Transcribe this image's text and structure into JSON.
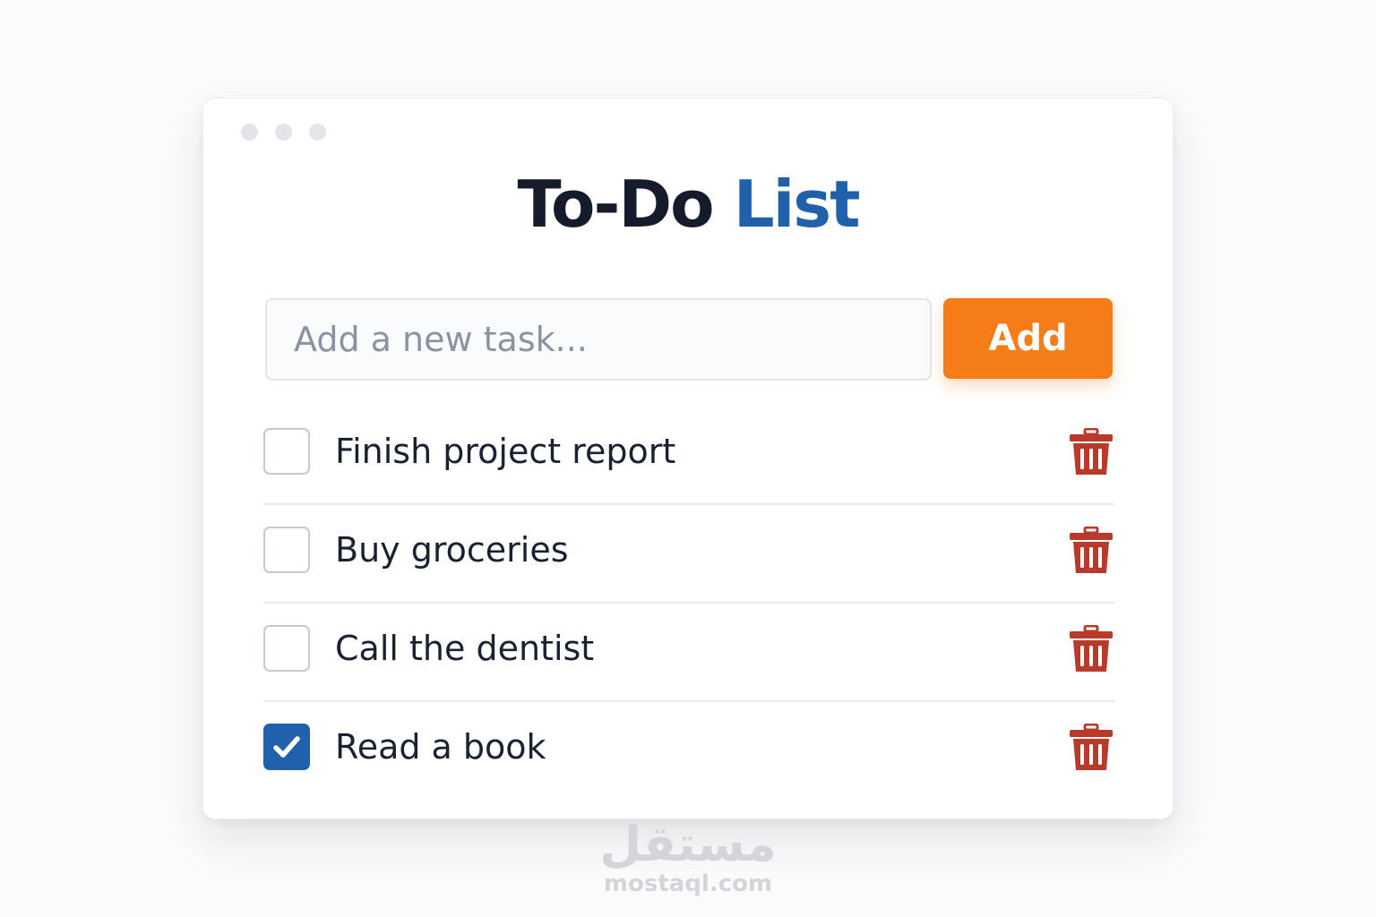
{
  "window": {
    "title_part1": "To-Do",
    "title_part2": "List"
  },
  "input": {
    "placeholder": "Add a new task...",
    "value": ""
  },
  "add_button": {
    "label": "Add"
  },
  "tasks": [
    {
      "label": "Finish project report",
      "done": false
    },
    {
      "label": "Buy groceries",
      "done": false
    },
    {
      "label": "Call the dentist",
      "done": false
    },
    {
      "label": "Read a book",
      "done": true
    }
  ],
  "icons": {
    "delete": "trash-icon",
    "check": "checkmark-icon"
  },
  "colors": {
    "accent_blue": "#2161ab",
    "add_orange": "#f57c17",
    "delete_red": "#b83a2a",
    "title_dark": "#141b2b"
  },
  "watermark": {
    "logo": "مستقل",
    "domain": "mostaql.com"
  }
}
